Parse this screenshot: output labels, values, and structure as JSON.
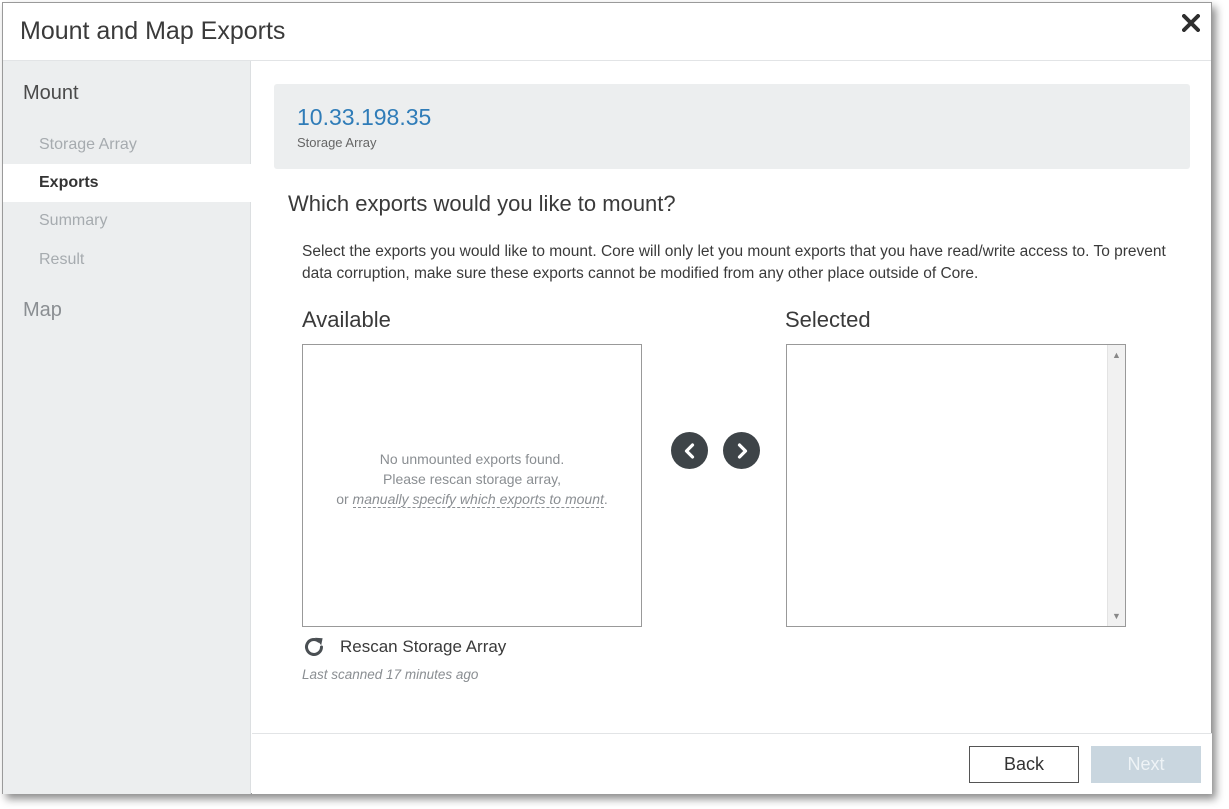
{
  "dialog": {
    "title": "Mount and Map Exports",
    "close_icon": "close-icon"
  },
  "sidebar": {
    "sections": [
      {
        "label": "Mount",
        "items": [
          {
            "label": "Storage Array",
            "state": "completed"
          },
          {
            "label": "Exports",
            "state": "active"
          },
          {
            "label": "Summary",
            "state": "pending"
          },
          {
            "label": "Result",
            "state": "pending"
          }
        ]
      },
      {
        "label": "Map",
        "items": []
      }
    ]
  },
  "storage": {
    "ip": "10.33.198.35",
    "type_label": "Storage Array"
  },
  "content": {
    "question": "Which exports would you like to mount?",
    "description": "Select the exports you would like to mount. Core will only let you mount exports that you have read/write access to. To prevent data corruption, make sure these exports cannot be modified from any other place outside of Core."
  },
  "available": {
    "label": "Available",
    "empty_line1": "No unmounted exports found.",
    "empty_line2": "Please rescan storage array,",
    "empty_prefix": "or ",
    "manual_link": "manually specify which exports to mount",
    "empty_suffix": "."
  },
  "selected": {
    "label": "Selected",
    "items": []
  },
  "transfer": {
    "left_icon": "chevron-left-icon",
    "right_icon": "chevron-right-icon"
  },
  "rescan": {
    "label": "Rescan Storage Array",
    "icon": "refresh-icon",
    "last_scanned": "Last scanned 17 minutes ago"
  },
  "footer": {
    "back_label": "Back",
    "next_label": "Next",
    "next_enabled": false
  },
  "colors": {
    "accent_blue": "#2f7cb8",
    "sidebar_bg": "#eceeef",
    "arrow_button": "#3e4448",
    "next_disabled": "#c9d6df"
  }
}
